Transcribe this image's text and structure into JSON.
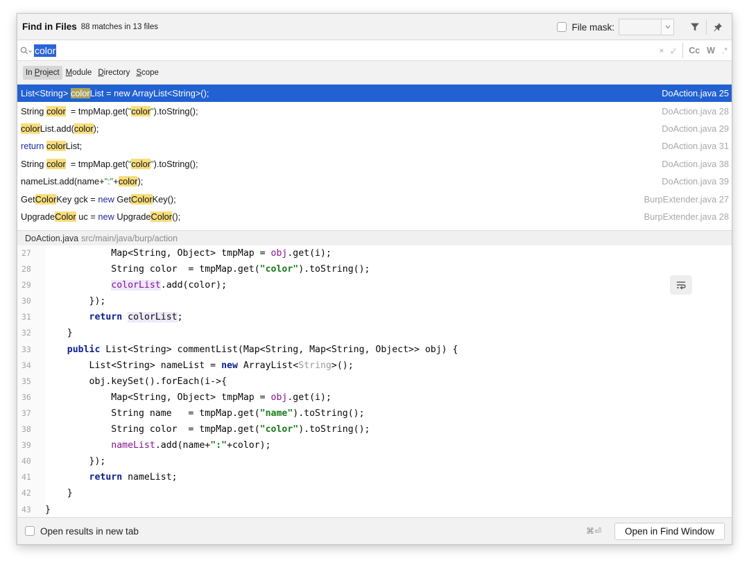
{
  "header": {
    "title": "Find in Files",
    "match_info": "88 matches in 13 files",
    "file_mask_label": "File mask:",
    "file_mask_value": ""
  },
  "search": {
    "query": "color",
    "options": {
      "close": "×",
      "newline": "⤦",
      "case": "Cc",
      "words": "W",
      "regex": ".*"
    }
  },
  "scopes": [
    {
      "prefix": "In ",
      "key": "P",
      "rest": "roject",
      "active": true
    },
    {
      "prefix": "",
      "key": "M",
      "rest": "odule",
      "active": false
    },
    {
      "prefix": "",
      "key": "D",
      "rest": "irectory",
      "active": false
    },
    {
      "prefix": "",
      "key": "S",
      "rest": "cope",
      "active": false
    }
  ],
  "results": [
    {
      "file": "DoAction.java 25",
      "selected": true,
      "parts": [
        [
          "t",
          "List<String> "
        ],
        [
          "h",
          "color"
        ],
        [
          "t",
          "List = "
        ],
        [
          "k",
          "new"
        ],
        [
          "t",
          " ArrayList<String>();"
        ]
      ]
    },
    {
      "file": "DoAction.java 28",
      "selected": false,
      "parts": [
        [
          "t",
          "String "
        ],
        [
          "h",
          "color"
        ],
        [
          "t",
          "  = tmpMap.get("
        ],
        [
          "s",
          "\""
        ],
        [
          "h",
          "color"
        ],
        [
          "s",
          "\""
        ],
        [
          "t",
          ").toString();"
        ]
      ]
    },
    {
      "file": "DoAction.java 29",
      "selected": false,
      "parts": [
        [
          "h",
          "color"
        ],
        [
          "t",
          "List.add("
        ],
        [
          "h",
          "color"
        ],
        [
          "t",
          ");"
        ]
      ]
    },
    {
      "file": "DoAction.java 31",
      "selected": false,
      "parts": [
        [
          "k",
          "return "
        ],
        [
          "h",
          "color"
        ],
        [
          "t",
          "List;"
        ]
      ]
    },
    {
      "file": "DoAction.java 38",
      "selected": false,
      "parts": [
        [
          "t",
          "String "
        ],
        [
          "h",
          "color"
        ],
        [
          "t",
          "  = tmpMap.get("
        ],
        [
          "s",
          "\""
        ],
        [
          "h",
          "color"
        ],
        [
          "s",
          "\""
        ],
        [
          "t",
          ").toString();"
        ]
      ]
    },
    {
      "file": "DoAction.java 39",
      "selected": false,
      "parts": [
        [
          "t",
          "nameList.add(name+"
        ],
        [
          "s",
          "\":\""
        ],
        [
          "t",
          "+"
        ],
        [
          "h",
          "color"
        ],
        [
          "t",
          ");"
        ]
      ]
    },
    {
      "file": "BurpExtender.java 27",
      "selected": false,
      "parts": [
        [
          "t",
          "Get"
        ],
        [
          "h",
          "Color"
        ],
        [
          "t",
          "Key gck = "
        ],
        [
          "k",
          "new"
        ],
        [
          "t",
          " Get"
        ],
        [
          "h",
          "Color"
        ],
        [
          "t",
          "Key();"
        ]
      ]
    },
    {
      "file": "BurpExtender.java 28",
      "selected": false,
      "parts": [
        [
          "t",
          "Upgrade"
        ],
        [
          "h",
          "Color"
        ],
        [
          "t",
          " uc = "
        ],
        [
          "k",
          "new"
        ],
        [
          "t",
          " Upgrade"
        ],
        [
          "h",
          "Color"
        ],
        [
          "t",
          "();"
        ]
      ]
    }
  ],
  "preview": {
    "file": "DoAction.java",
    "path": "src/main/java/burp/action",
    "lines": [
      {
        "n": "27",
        "parts": [
          [
            "t",
            "            Map<String, Object> tmpMap = "
          ],
          [
            "f",
            "obj"
          ],
          [
            "t",
            ".get(i);"
          ]
        ]
      },
      {
        "n": "28",
        "parts": [
          [
            "t",
            "            String color  = tmpMap.get("
          ],
          [
            "s",
            "\"color\""
          ],
          [
            "t",
            ").toString();"
          ]
        ]
      },
      {
        "n": "29",
        "parts": [
          [
            "t",
            "            "
          ],
          [
            "fh",
            "colorList"
          ],
          [
            "t",
            ".add(color);"
          ]
        ]
      },
      {
        "n": "30",
        "parts": [
          [
            "t",
            "        });"
          ]
        ]
      },
      {
        "n": "31",
        "parts": [
          [
            "t",
            "        "
          ],
          [
            "k",
            "return"
          ],
          [
            "t",
            " "
          ],
          [
            "fh2",
            "colorList"
          ],
          [
            "t",
            ";"
          ]
        ]
      },
      {
        "n": "32",
        "parts": [
          [
            "t",
            "    }"
          ]
        ]
      },
      {
        "n": "33",
        "parts": [
          [
            "t",
            "    "
          ],
          [
            "k",
            "public"
          ],
          [
            "t",
            " List<String> commentList(Map<String, Map<String, Object>> obj) {"
          ]
        ]
      },
      {
        "n": "34",
        "parts": [
          [
            "t",
            "        List<String> nameList = "
          ],
          [
            "k",
            "new"
          ],
          [
            "t",
            " ArrayList<"
          ],
          [
            "g",
            "String"
          ],
          [
            "t",
            ">();"
          ]
        ]
      },
      {
        "n": "35",
        "parts": [
          [
            "t",
            "        obj.keySet().forEach(i->{"
          ]
        ]
      },
      {
        "n": "36",
        "parts": [
          [
            "t",
            "            Map<String, Object> tmpMap = "
          ],
          [
            "f",
            "obj"
          ],
          [
            "t",
            ".get(i);"
          ]
        ]
      },
      {
        "n": "37",
        "parts": [
          [
            "t",
            "            String name   = tmpMap.get("
          ],
          [
            "s",
            "\"name\""
          ],
          [
            "t",
            ").toString();"
          ]
        ]
      },
      {
        "n": "38",
        "parts": [
          [
            "t",
            "            String color  = tmpMap.get("
          ],
          [
            "s",
            "\"color\""
          ],
          [
            "t",
            ").toString();"
          ]
        ]
      },
      {
        "n": "39",
        "parts": [
          [
            "t",
            "            "
          ],
          [
            "f",
            "nameList"
          ],
          [
            "t",
            ".add(name+"
          ],
          [
            "s",
            "\":\""
          ],
          [
            "t",
            "+color);"
          ]
        ]
      },
      {
        "n": "40",
        "parts": [
          [
            "t",
            "        });"
          ]
        ]
      },
      {
        "n": "41",
        "parts": [
          [
            "t",
            "        "
          ],
          [
            "k",
            "return"
          ],
          [
            "t",
            " nameList;"
          ]
        ]
      },
      {
        "n": "42",
        "parts": [
          [
            "t",
            "    }"
          ]
        ]
      },
      {
        "n": "43",
        "parts": [
          [
            "t",
            "}"
          ]
        ]
      }
    ]
  },
  "footer": {
    "open_new_tab_label": "Open results in new tab",
    "shortcut": "⌘⏎",
    "open_window_label": "Open in Find Window"
  },
  "colors": {
    "selection": "#2161d2",
    "match_highlight": "#f7dd7d",
    "search_selection": "#2b64d6"
  },
  "icons": [
    "search-icon",
    "filter-icon",
    "pin-icon",
    "chevron-down-icon",
    "soft-wrap-icon"
  ]
}
